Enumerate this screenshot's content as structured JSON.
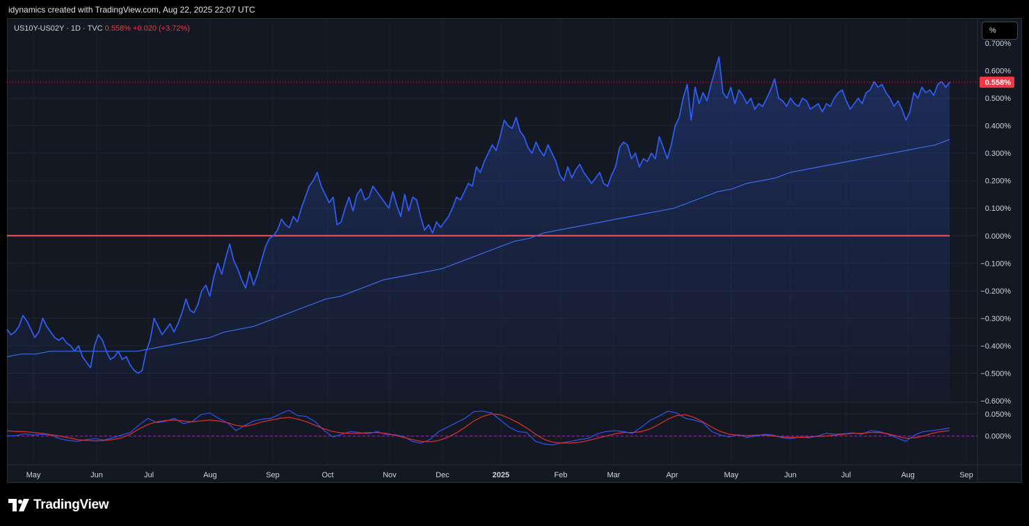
{
  "header": {
    "attribution": "idynamics created with TradingView.com, Aug 22, 2025 22:07 UTC"
  },
  "legend": {
    "symbol": "US10Y-US02Y · 1D · TVC",
    "last": "0.558%",
    "change": "+0.020 (+3.72%)"
  },
  "scale_button": "%",
  "brand": "TradingView",
  "colors": {
    "price_line": "#2f5cf0",
    "sma_line": "#3a6df0",
    "zero_line": "#f7525f",
    "last_badge": "#f23645",
    "osc_fast": "#2f4fe8",
    "osc_slow": "#d32f2f"
  },
  "chart_data": [
    {
      "type": "area",
      "series": [
        {
          "values": [
            -0.34,
            -0.36,
            -0.35,
            -0.33,
            -0.29,
            -0.31,
            -0.34,
            -0.37,
            -0.35,
            -0.3,
            -0.33,
            -0.35,
            -0.37,
            -0.38,
            -0.37,
            -0.39,
            -0.4,
            -0.42,
            -0.4,
            -0.44,
            -0.46,
            -0.48,
            -0.4,
            -0.36,
            -0.38,
            -0.42,
            -0.45,
            -0.44,
            -0.42,
            -0.45,
            -0.44,
            -0.47,
            -0.49,
            -0.5,
            -0.49,
            -0.42,
            -0.38,
            -0.3,
            -0.33,
            -0.36,
            -0.34,
            -0.32,
            -0.35,
            -0.32,
            -0.28,
            -0.23,
            -0.27,
            -0.28,
            -0.25,
            -0.2,
            -0.18,
            -0.22,
            -0.15,
            -0.1,
            -0.14,
            -0.08,
            -0.03,
            -0.09,
            -0.12,
            -0.16,
            -0.19,
            -0.13,
            -0.18,
            -0.14,
            -0.09,
            -0.04,
            -0.01,
            0.0,
            0.02,
            0.06,
            0.04,
            0.03,
            0.07,
            0.05,
            0.1,
            0.14,
            0.18,
            0.2,
            0.23,
            0.18,
            0.15,
            0.12,
            0.14,
            0.04,
            0.05,
            0.1,
            0.14,
            0.09,
            0.15,
            0.17,
            0.13,
            0.14,
            0.18,
            0.16,
            0.14,
            0.12,
            0.1,
            0.16,
            0.11,
            0.07,
            0.15,
            0.09,
            0.14,
            0.13,
            0.07,
            0.02,
            0.04,
            0.01,
            0.05,
            0.03,
            0.05,
            0.07,
            0.1,
            0.14,
            0.13,
            0.16,
            0.19,
            0.18,
            0.25,
            0.23,
            0.27,
            0.3,
            0.33,
            0.31,
            0.36,
            0.42,
            0.4,
            0.39,
            0.43,
            0.38,
            0.36,
            0.32,
            0.3,
            0.34,
            0.31,
            0.29,
            0.33,
            0.3,
            0.27,
            0.22,
            0.2,
            0.25,
            0.21,
            0.24,
            0.26,
            0.23,
            0.21,
            0.19,
            0.21,
            0.23,
            0.19,
            0.18,
            0.22,
            0.25,
            0.32,
            0.34,
            0.33,
            0.28,
            0.3,
            0.25,
            0.28,
            0.27,
            0.3,
            0.28,
            0.36,
            0.32,
            0.28,
            0.33,
            0.4,
            0.43,
            0.5,
            0.55,
            0.42,
            0.54,
            0.48,
            0.52,
            0.49,
            0.55,
            0.6,
            0.65,
            0.52,
            0.5,
            0.54,
            0.48,
            0.53,
            0.51,
            0.48,
            0.5,
            0.46,
            0.48,
            0.47,
            0.5,
            0.53,
            0.57,
            0.5,
            0.49,
            0.47,
            0.5,
            0.48,
            0.47,
            0.5,
            0.49,
            0.46,
            0.47,
            0.48,
            0.45,
            0.48,
            0.47,
            0.5,
            0.52,
            0.53,
            0.49,
            0.46,
            0.48,
            0.5,
            0.48,
            0.52,
            0.53,
            0.56,
            0.54,
            0.55,
            0.52,
            0.5,
            0.47,
            0.49,
            0.46,
            0.42,
            0.45,
            0.52,
            0.5,
            0.54,
            0.52,
            0.53,
            0.51,
            0.55,
            0.56,
            0.54,
            0.558
          ]
        },
        {
          "values": [
            -0.44,
            -0.43,
            -0.43,
            -0.42,
            -0.42,
            -0.42,
            -0.42,
            -0.42,
            -0.42,
            -0.42,
            -0.41,
            -0.4,
            -0.39,
            -0.38,
            -0.37,
            -0.35,
            -0.34,
            -0.33,
            -0.31,
            -0.29,
            -0.27,
            -0.25,
            -0.23,
            -0.22,
            -0.2,
            -0.18,
            -0.16,
            -0.15,
            -0.14,
            -0.13,
            -0.12,
            -0.1,
            -0.08,
            -0.06,
            -0.04,
            -0.02,
            -0.01,
            0.01,
            0.02,
            0.03,
            0.04,
            0.05,
            0.06,
            0.07,
            0.08,
            0.09,
            0.1,
            0.12,
            0.14,
            0.16,
            0.17,
            0.19,
            0.2,
            0.21,
            0.23,
            0.24,
            0.25,
            0.26,
            0.27,
            0.28,
            0.29,
            0.3,
            0.31,
            0.32,
            0.33,
            0.35
          ]
        }
      ],
      "y_ticks": [
        "0.700%",
        "0.600%",
        "0.500%",
        "0.400%",
        "0.300%",
        "0.200%",
        "0.100%",
        "0.000%",
        "−0.100%",
        "−0.200%",
        "−0.300%",
        "−0.400%",
        "−0.500%",
        "−0.600%"
      ],
      "ylim": [
        -0.6,
        0.7
      ],
      "reference_line": 0.0,
      "last_value_label": "0.558%"
    },
    {
      "type": "line",
      "series": [
        {
          "values": [
            0.0,
            0.001,
            0.005,
            0.002,
            0.004,
            0.002,
            -0.006,
            -0.01,
            -0.012,
            -0.008,
            -0.006,
            -0.009,
            -0.004,
            0.002,
            0.008,
            0.025,
            0.04,
            0.03,
            0.033,
            0.04,
            0.028,
            0.032,
            0.048,
            0.052,
            0.04,
            0.03,
            0.012,
            0.024,
            0.034,
            0.038,
            0.04,
            0.05,
            0.058,
            0.046,
            0.044,
            0.032,
            0.012,
            -0.002,
            0.004,
            0.01,
            0.008,
            0.005,
            0.01,
            0.004,
            0.003,
            -0.001,
            -0.012,
            -0.016,
            -0.008,
            0.01,
            0.02,
            0.03,
            0.04,
            0.055,
            0.056,
            0.052,
            0.036,
            0.02,
            0.01,
            0.008,
            -0.012,
            -0.018,
            -0.02,
            -0.015,
            -0.012,
            -0.008,
            -0.005,
            0.005,
            0.01,
            0.012,
            0.01,
            0.006,
            0.02,
            0.035,
            0.045,
            0.056,
            0.052,
            0.04,
            0.036,
            0.03,
            0.01,
            0.002,
            -0.002,
            0.003,
            -0.003,
            0.0,
            0.004,
            0.002,
            -0.004,
            -0.006,
            -0.002,
            -0.004,
            0.0,
            0.006,
            0.004,
            0.005,
            0.007,
            0.004,
            0.012,
            0.01,
            0.004,
            -0.004,
            -0.012,
            0.002,
            0.01,
            0.012,
            0.015,
            0.018
          ]
        },
        {
          "values": [
            0.012,
            0.01,
            0.01,
            0.008,
            0.006,
            0.003,
            0.0,
            -0.004,
            -0.008,
            -0.01,
            -0.011,
            -0.01,
            -0.008,
            -0.004,
            0.004,
            0.016,
            0.026,
            0.032,
            0.035,
            0.036,
            0.034,
            0.032,
            0.034,
            0.036,
            0.034,
            0.03,
            0.024,
            0.022,
            0.026,
            0.032,
            0.036,
            0.04,
            0.042,
            0.038,
            0.032,
            0.024,
            0.016,
            0.01,
            0.007,
            0.006,
            0.006,
            0.008,
            0.008,
            0.006,
            0.002,
            -0.003,
            -0.008,
            -0.012,
            -0.013,
            -0.01,
            -0.003,
            0.007,
            0.02,
            0.034,
            0.044,
            0.05,
            0.048,
            0.04,
            0.03,
            0.018,
            0.004,
            -0.008,
            -0.014,
            -0.016,
            -0.016,
            -0.014,
            -0.01,
            -0.005,
            0.0,
            0.005,
            0.008,
            0.008,
            0.01,
            0.016,
            0.026,
            0.038,
            0.046,
            0.048,
            0.042,
            0.032,
            0.02,
            0.01,
            0.004,
            0.002,
            0.001,
            0.002,
            0.002,
            0.0,
            -0.002,
            -0.003,
            -0.003,
            -0.002,
            -0.001,
            0.0,
            0.002,
            0.004,
            0.006,
            0.006,
            0.008,
            0.008,
            0.005,
            0.0,
            -0.005,
            -0.004,
            0.0,
            0.006,
            0.01,
            0.012
          ]
        }
      ],
      "y_ticks": [
        "0.050%",
        "0.000%"
      ],
      "ylim": [
        -0.06,
        0.07
      ],
      "reference_line": 0.0
    }
  ],
  "x_axis": {
    "ticks": [
      "May",
      "Jun",
      "Jul",
      "Aug",
      "Sep",
      "Oct",
      "Nov",
      "Dec",
      "2025",
      "Feb",
      "Mar",
      "Apr",
      "May",
      "Jun",
      "Jul",
      "Aug",
      "Sep"
    ]
  }
}
